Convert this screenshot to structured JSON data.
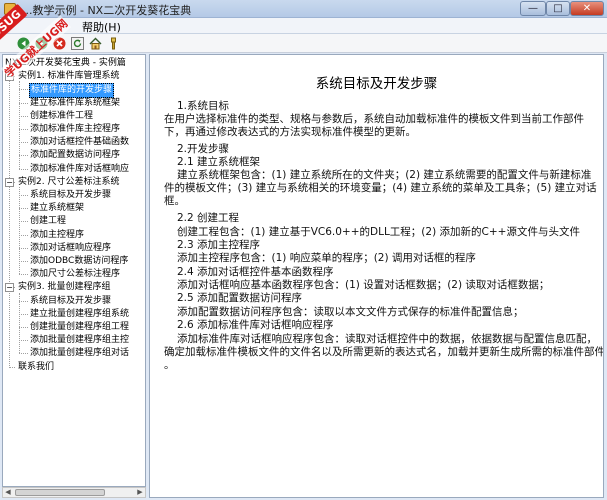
{
  "window": {
    "title": "...教学示例 - NX二次开发葵花宝典",
    "min_label": "—",
    "max_label": "□",
    "close_label": "✕"
  },
  "menu": {
    "items": [
      "帮助(H)"
    ]
  },
  "toolbar": {
    "buttons": [
      "back-icon",
      "forward-icon",
      "stop-icon",
      "refresh-icon",
      "home-icon",
      "help-icon"
    ]
  },
  "watermark": {
    "badge": "9SUG",
    "text": "学UG就上UG网"
  },
  "tree": {
    "root": "NX二次开发葵花宝典 - 实例篇",
    "items": [
      {
        "label": "实例1. 标准件库管理系统",
        "level": 1,
        "expanded": true
      },
      {
        "label": "标准件库的开发步骤",
        "level": 2,
        "selected": true
      },
      {
        "label": "建立标准件库系统框架",
        "level": 2
      },
      {
        "label": "创建标准件工程",
        "level": 2
      },
      {
        "label": "添加标准件库主控程序",
        "level": 2
      },
      {
        "label": "添加对话框控件基础函数",
        "level": 2
      },
      {
        "label": "添加配置数据访问程序",
        "level": 2
      },
      {
        "label": "添加标准件库对话框响应",
        "level": 2
      },
      {
        "label": "实例2. 尺寸公差标注系统",
        "level": 1,
        "expanded": true
      },
      {
        "label": "系统目标及开发步骤",
        "level": 2
      },
      {
        "label": "建立系统框架",
        "level": 2
      },
      {
        "label": "创建工程",
        "level": 2
      },
      {
        "label": "添加主控程序",
        "level": 2
      },
      {
        "label": "添加对话框响应程序",
        "level": 2
      },
      {
        "label": "添加ODBC数据访问程序",
        "level": 2
      },
      {
        "label": "添加尺寸公差标注程序",
        "level": 2
      },
      {
        "label": "实例3. 批量创建程序组",
        "level": 1,
        "expanded": true
      },
      {
        "label": "系统目标及开发步骤",
        "level": 2
      },
      {
        "label": "建立批量创建程序组系统",
        "level": 2
      },
      {
        "label": "创建批量创建程序组工程",
        "level": 2
      },
      {
        "label": "添加批量创建程序组主控",
        "level": 2
      },
      {
        "label": "添加批量创建程序组对话",
        "level": 2
      },
      {
        "label": "联系我们",
        "level": 1
      }
    ]
  },
  "document": {
    "title": "系统目标及开发步骤",
    "lines": [
      "1.系统目标",
      "在用户选择标准件的类型、规格与参数后，系统自动加载标准件的模板文件到当前工作部件",
      "下，再通过修改表达式的方法实现标准件模型的更新。",
      "2.开发步骤",
      "2.1 建立系统框架",
      "建立系统框架包含：(1) 建立系统所在的文件夹；(2) 建立系统需要的配置文件与新建标准",
      "件的模板文件；(3) 建立与系统相关的环境变量；(4) 建立系统的菜单及工具条；(5) 建立对话",
      "框。",
      "2.2 创建工程",
      "创建工程包含：(1) 建立基于VC6.0++的DLL工程；(2) 添加新的C++源文件与头文件",
      "2.3 添加主控程序",
      "添加主控程序包含：(1) 响应菜单的程序；(2) 调用对话框的程序",
      "2.4 添加对话框控件基本函数程序",
      "添加对话框响应基本函数程序包含：(1) 设置对话框数据；(2) 读取对话框数据；",
      "2.5 添加配置数据访问程序",
      "添加配置数据访问程序包含：读取以本文文件方式保存的标准件配置信息；",
      "2.6 添加标准件库对话框响应程序",
      "添加标准件库对话框响应程序包含：读取对话框控件中的数据，依据数据与配置信息匹配，",
      "确定加载标准件模板文件的文件名以及所需更新的表达式名，加载并更新生成所需的标准件部件",
      "。"
    ]
  },
  "colors": {
    "selection": "#3399ff",
    "watermark": "#d81e1e",
    "window_frame": "#b4c9e6"
  }
}
